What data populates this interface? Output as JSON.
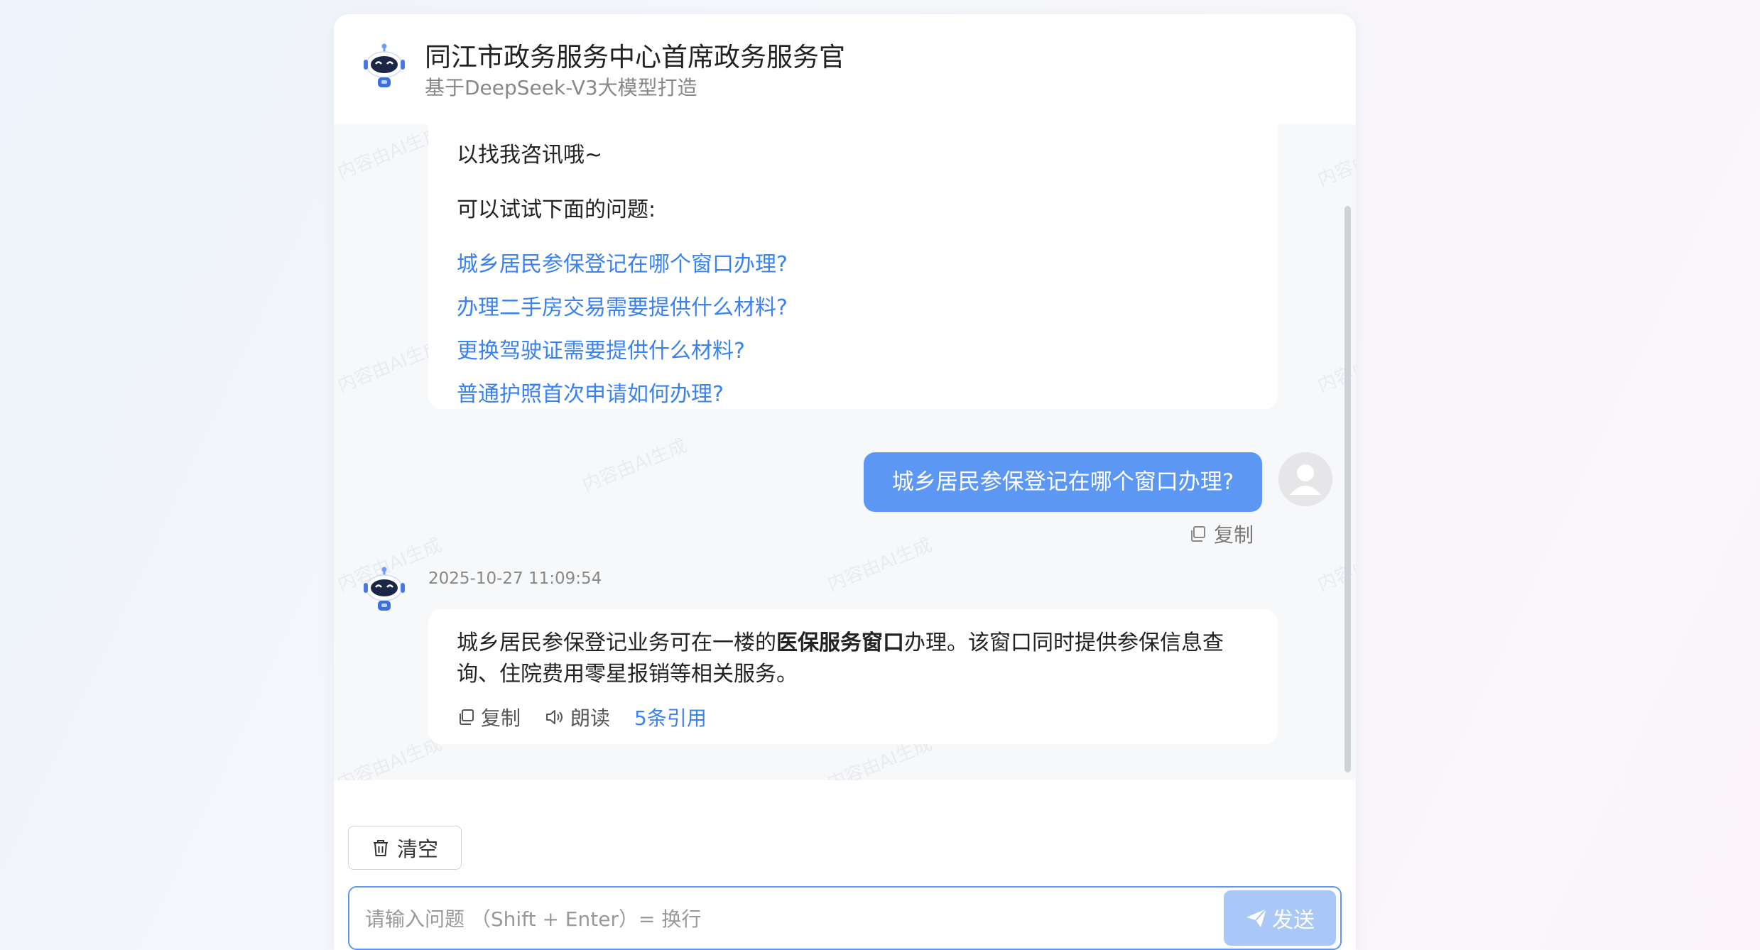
{
  "header": {
    "title": "同江市政务服务中心首席政务服务官",
    "subtitle": "基于DeepSeek-V3大模型打造"
  },
  "watermark": "内容由AI生成",
  "welcome": {
    "line_tail": "以找我咨讯哦~",
    "suggest_label": "可以试试下面的问题:",
    "questions": [
      "城乡居民参保登记在哪个窗口办理?",
      "办理二手房交易需要提供什么材料?",
      "更换驾驶证需要提供什么材料?",
      "普通护照首次申请如何办理?"
    ]
  },
  "user_message": {
    "text": "城乡居民参保登记在哪个窗口办理?",
    "copy_label": "复制"
  },
  "bot_answer": {
    "timestamp": "2025-10-27 11:09:54",
    "line1_pre": "城乡居民参保登记业务可在一楼的",
    "line1_bold": "医保服务窗口",
    "line1_post": "办理。该窗口同时提供参保信息查",
    "line2": "询、住院费用零星报销等相关服务。",
    "copy_label": "复制",
    "read_label": "朗读",
    "citations_label": "5条引用"
  },
  "footer": {
    "clear_label": "清空",
    "input_placeholder": "请输入问题 （Shift + Enter）= 换行",
    "send_label": "发送"
  },
  "colors": {
    "accent": "#3a82f0",
    "user_bubble": "#5b97f3",
    "send_button": "#a9c8f7"
  }
}
